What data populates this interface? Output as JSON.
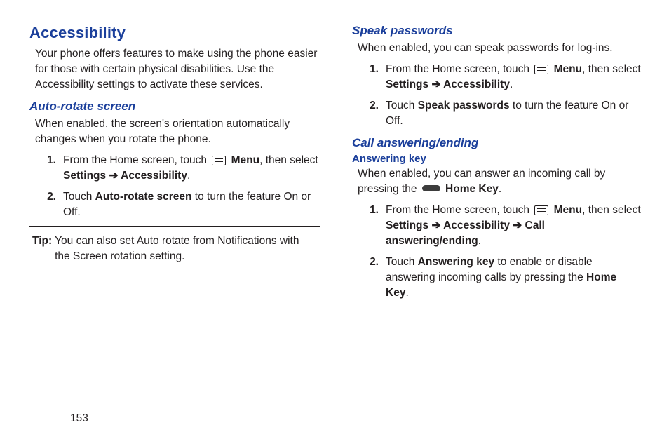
{
  "page_number": "153",
  "left": {
    "heading": "Accessibility",
    "intro": "Your phone offers features to make using the phone easier for those with certain physical disabilities. Use the Accessibility settings to activate these services.",
    "sub1": "Auto-rotate screen",
    "sub1_intro": "When enabled, the screen's orientation automatically changes when you rotate the phone.",
    "step1_num": "1.",
    "step1_a": "From the Home screen, touch ",
    "step1_menu": " Menu",
    "step1_b": ", then select ",
    "step1_settings": "Settings ",
    "step1_arrow": "➔ ",
    "step1_access": "Accessibility",
    "step1_c": ".",
    "step2_num": "2.",
    "step2_a": "Touch ",
    "step2_bold": "Auto-rotate screen",
    "step2_b": " to turn the feature On or Off.",
    "tip_label": "Tip: ",
    "tip_text": "You can also set Auto rotate from Notifications with the Screen rotation setting."
  },
  "right": {
    "sp_heading": "Speak passwords",
    "sp_intro": "When enabled, you can speak passwords for log-ins.",
    "sp1_num": "1.",
    "sp1_a": "From the Home screen, touch ",
    "sp1_menu": " Menu",
    "sp1_b": ", then select ",
    "sp1_settings": "Settings ",
    "sp1_arrow": "➔ ",
    "sp1_access": "Accessibility",
    "sp1_c": ".",
    "sp2_num": "2.",
    "sp2_a": "Touch ",
    "sp2_bold": "Speak passwords",
    "sp2_b": " to turn the feature On or Off.",
    "ca_heading": "Call answering/ending",
    "ak_heading": "Answering key",
    "ak_intro_a": "When enabled, you can answer an incoming call by pressing the ",
    "ak_intro_bold": " Home Key",
    "ak_intro_b": ".",
    "ak1_num": "1.",
    "ak1_a": "From the Home screen, touch ",
    "ak1_menu": " Menu",
    "ak1_b": ", then select ",
    "ak1_settings": "Settings ",
    "ak1_arrow1": "➔ ",
    "ak1_access": "Accessibility ",
    "ak1_arrow2": "➔ ",
    "ak1_cae": "Call answering/ending",
    "ak1_c": ".",
    "ak2_num": "2.",
    "ak2_a": "Touch ",
    "ak2_bold": "Answering key",
    "ak2_b": " to enable or disable answering incoming calls by pressing the ",
    "ak2_bold2": "Home Key",
    "ak2_c": "."
  }
}
